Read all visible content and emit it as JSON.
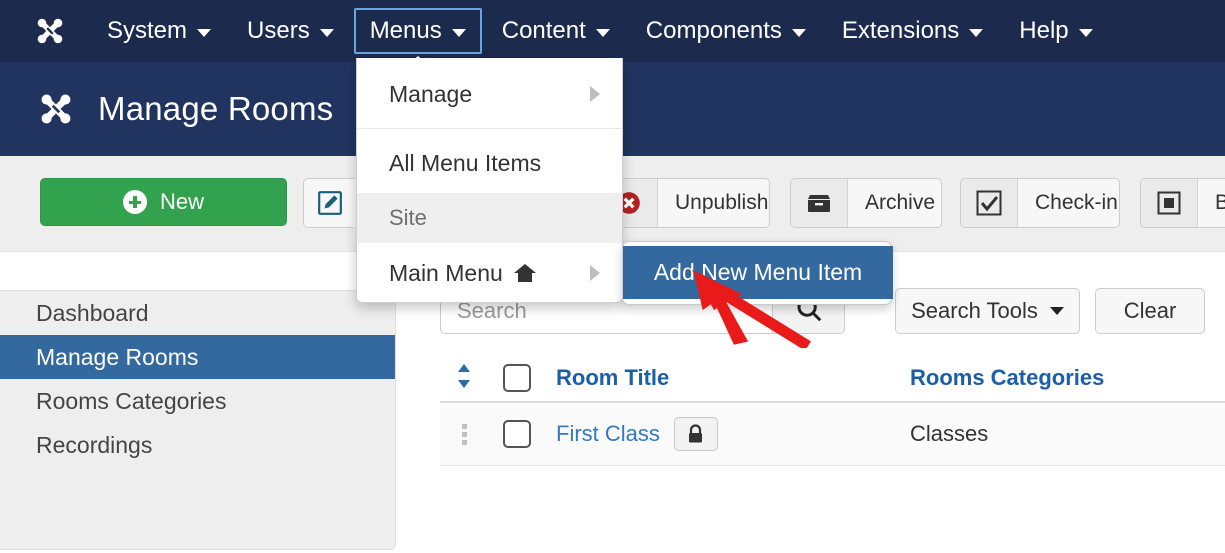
{
  "topnav": {
    "logo_icon": "joomla-logo-icon",
    "items": [
      {
        "label": "System",
        "caret": true
      },
      {
        "label": "Users",
        "caret": true
      },
      {
        "label": "Menus",
        "caret": true,
        "active": true
      },
      {
        "label": "Content",
        "caret": true
      },
      {
        "label": "Components",
        "caret": true
      },
      {
        "label": "Extensions",
        "caret": true
      },
      {
        "label": "Help",
        "caret": true
      }
    ]
  },
  "page_header": {
    "logo_icon": "joomla-logo-icon",
    "title": "Manage Rooms"
  },
  "toolbar": {
    "new_label": "New",
    "new_icon": "plus-circle-icon",
    "edit_icon": "edit-pencil-icon",
    "check_icon": "check-square-icon",
    "unpublish_label": "Unpublish",
    "unpublish_icon": "red-x-circle-icon",
    "archive_label": "Archive",
    "archive_icon": "archive-box-icon",
    "checkin_label": "Check-in",
    "checkin_icon": "checkbox-checked-icon",
    "batch_label": "Ba",
    "batch_icon": "stop-square-icon"
  },
  "sidebar": {
    "items": [
      {
        "label": "Dashboard",
        "active": false
      },
      {
        "label": "Manage Rooms",
        "active": true
      },
      {
        "label": "Rooms Categories",
        "active": false
      },
      {
        "label": "Recordings",
        "active": false
      }
    ]
  },
  "search": {
    "value": "",
    "placeholder": "Search",
    "search_icon": "magnifier-icon",
    "search_tools_label": "Search Tools",
    "clear_label": "Clear"
  },
  "table": {
    "sort_icon": "sort-updown-icon",
    "headers": {
      "room_title": "Room Title",
      "rooms_categories": "Rooms Categories"
    },
    "rows": [
      {
        "drag_icon": "drag-handle-icon",
        "title": "First Class",
        "lock_icon": "lock-icon",
        "category": "Classes"
      }
    ]
  },
  "dropdown": {
    "manage_label": "Manage",
    "all_menu_items_label": "All Menu Items",
    "site_header_label": "Site",
    "main_menu_label": "Main Menu",
    "main_menu_icon": "home-icon",
    "submenu_arrow_icon": "chevron-right-icon"
  },
  "submenu": {
    "add_new_menu_item_label": "Add New Menu Item"
  },
  "annotation": {
    "arrow_icon": "red-pointer-arrow-icon",
    "arrow_color": "#e81a1a"
  },
  "colors": {
    "topnav_bg": "#1c2a4e",
    "header_bg": "#21335f",
    "accent_blue": "#34699f",
    "link_blue": "#3478c0",
    "header_link_blue": "#1b5faa",
    "new_green": "#32a24f",
    "focus_outline": "#6ba4de"
  }
}
